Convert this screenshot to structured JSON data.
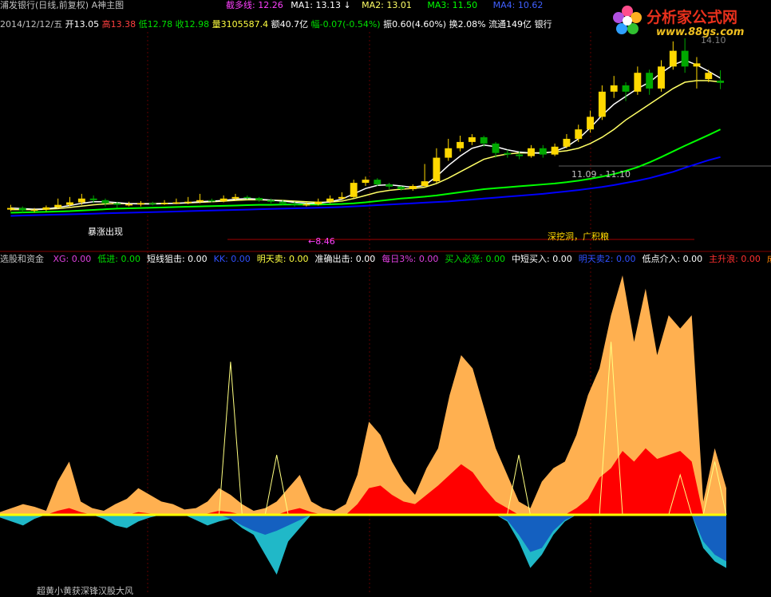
{
  "colors": {
    "background": "#000000",
    "up": "#ffd800",
    "down": "#00a800",
    "ma1": "#ffffff",
    "ma2": "#ffff66",
    "ma3": "#00ff00",
    "ma4": "#0000ff",
    "orange_area": "#ffb050",
    "red_area": "#ff0000",
    "cyan_area": "#20b8c8",
    "blue_area": "#1460c0",
    "zero_line": "#ffff00"
  },
  "header": {
    "title": "浦发银行(日线,前复权) A神主图",
    "ind1_label": "截多线:",
    "ind1_value": "12.26",
    "ma1_label": "MA1:",
    "ma1_value": "13.13",
    "ma1_arrow": "↓",
    "ma2_label": "MA2:",
    "ma2_value": "13.01",
    "ma3_label": "MA3:",
    "ma3_value": "11.50",
    "ma4_label": "MA4:",
    "ma4_value": "10.62"
  },
  "quote": {
    "date": "2014/12/12/五",
    "open": "开13.05",
    "high": "高13.38",
    "low": "低12.78",
    "close": "收12.98",
    "volume": "量3105587.4",
    "amount": "额40.7亿",
    "change": "幅-0.07(-0.54%)",
    "amplitude": "振0.60(4.60%)",
    "turnover": "换2.08%",
    "float_cap": "流通149亿",
    "sector": "银行"
  },
  "logo": {
    "title": "分析家公式网",
    "url": "www.88gs.com"
  },
  "annotations": {
    "hi": "14.10",
    "mid_label": "11.09 - 11.10",
    "low_label": "←8.46",
    "signal_text": "深挖洞，广积粮",
    "left_text": "暴涨出现",
    "bottom_text": "超黄小黄获深锋汉股大风"
  },
  "sub": {
    "title": "选股和资金",
    "items": [
      {
        "label": "XG: 0.00",
        "color": "#e040e0"
      },
      {
        "label": "低进: 0.00",
        "color": "#00e000"
      },
      {
        "label": "短线狙击: 0.00",
        "color": "#ffffff"
      },
      {
        "label": "KK: 0.00",
        "color": "#3050ff"
      },
      {
        "label": "明天卖: 0.00",
        "color": "#ffff40"
      },
      {
        "label": "准确出击: 0.00",
        "color": "#ffffff"
      },
      {
        "label": "每日3%: 0.00",
        "color": "#e040e0"
      },
      {
        "label": "买入必涨: 0.00",
        "color": "#00e000"
      },
      {
        "label": "中短买入: 0.00",
        "color": "#ffffff"
      },
      {
        "label": "明天卖2: 0.00",
        "color": "#3050ff"
      },
      {
        "label": "低点介入: 0.00",
        "color": "#ffffff"
      },
      {
        "label": "主升浪: 0.00",
        "color": "#ff3030"
      },
      {
        "label": "成",
        "color": "#ff8000"
      }
    ]
  },
  "chart_data": [
    {
      "type": "candlestick",
      "title": "浦发银行(日线,前复权) A神主图",
      "ylim": [
        8.0,
        14.6
      ],
      "candles": [
        {
          "o": 8.95,
          "c": 9.0,
          "h": 9.1,
          "l": 8.9
        },
        {
          "o": 9.0,
          "c": 8.92,
          "h": 9.05,
          "l": 8.85
        },
        {
          "o": 8.92,
          "c": 8.95,
          "h": 9.0,
          "l": 8.86
        },
        {
          "o": 8.95,
          "c": 9.02,
          "h": 9.08,
          "l": 8.9
        },
        {
          "o": 9.02,
          "c": 9.1,
          "h": 9.3,
          "l": 9.0
        },
        {
          "o": 9.1,
          "c": 9.18,
          "h": 9.35,
          "l": 9.05
        },
        {
          "o": 9.18,
          "c": 9.3,
          "h": 9.45,
          "l": 9.1
        },
        {
          "o": 9.3,
          "c": 9.25,
          "h": 9.4,
          "l": 9.15
        },
        {
          "o": 9.25,
          "c": 9.15,
          "h": 9.3,
          "l": 9.05
        },
        {
          "o": 9.15,
          "c": 9.1,
          "h": 9.2,
          "l": 9.0
        },
        {
          "o": 9.1,
          "c": 9.12,
          "h": 9.2,
          "l": 9.05
        },
        {
          "o": 9.12,
          "c": 9.15,
          "h": 9.22,
          "l": 9.05
        },
        {
          "o": 9.15,
          "c": 9.12,
          "h": 9.2,
          "l": 9.08
        },
        {
          "o": 9.12,
          "c": 9.16,
          "h": 9.25,
          "l": 9.1
        },
        {
          "o": 9.16,
          "c": 9.18,
          "h": 9.3,
          "l": 9.12
        },
        {
          "o": 9.18,
          "c": 9.2,
          "h": 9.35,
          "l": 9.12
        },
        {
          "o": 9.2,
          "c": 9.25,
          "h": 9.45,
          "l": 9.15
        },
        {
          "o": 9.25,
          "c": 9.22,
          "h": 9.3,
          "l": 9.18
        },
        {
          "o": 9.22,
          "c": 9.3,
          "h": 9.4,
          "l": 9.18
        },
        {
          "o": 9.3,
          "c": 9.35,
          "h": 9.45,
          "l": 9.25
        },
        {
          "o": 9.35,
          "c": 9.32,
          "h": 9.4,
          "l": 9.28
        },
        {
          "o": 9.32,
          "c": 9.25,
          "h": 9.35,
          "l": 9.2
        },
        {
          "o": 9.25,
          "c": 9.2,
          "h": 9.3,
          "l": 9.15
        },
        {
          "o": 9.2,
          "c": 9.15,
          "h": 9.25,
          "l": 9.1
        },
        {
          "o": 9.15,
          "c": 9.1,
          "h": 9.2,
          "l": 9.05
        },
        {
          "o": 9.1,
          "c": 9.12,
          "h": 9.18,
          "l": 9.05
        },
        {
          "o": 9.12,
          "c": 9.2,
          "h": 9.3,
          "l": 9.08
        },
        {
          "o": 9.2,
          "c": 9.3,
          "h": 9.4,
          "l": 9.15
        },
        {
          "o": 9.3,
          "c": 9.35,
          "h": 9.5,
          "l": 9.25
        },
        {
          "o": 9.35,
          "c": 9.8,
          "h": 9.9,
          "l": 9.3
        },
        {
          "o": 9.8,
          "c": 9.9,
          "h": 10.0,
          "l": 9.7
        },
        {
          "o": 9.9,
          "c": 9.75,
          "h": 9.95,
          "l": 9.7
        },
        {
          "o": 9.75,
          "c": 9.68,
          "h": 9.8,
          "l": 9.6
        },
        {
          "o": 9.68,
          "c": 9.6,
          "h": 9.7,
          "l": 9.55
        },
        {
          "o": 9.6,
          "c": 9.7,
          "h": 9.75,
          "l": 9.55
        },
        {
          "o": 9.7,
          "c": 9.85,
          "h": 10.4,
          "l": 9.65
        },
        {
          "o": 9.85,
          "c": 10.6,
          "h": 10.9,
          "l": 9.8
        },
        {
          "o": 10.6,
          "c": 10.9,
          "h": 11.2,
          "l": 10.5
        },
        {
          "o": 10.9,
          "c": 11.1,
          "h": 11.3,
          "l": 10.8
        },
        {
          "o": 11.1,
          "c": 11.25,
          "h": 11.35,
          "l": 11.0
        },
        {
          "o": 11.25,
          "c": 11.05,
          "h": 11.3,
          "l": 10.95
        },
        {
          "o": 11.05,
          "c": 10.75,
          "h": 11.1,
          "l": 10.6
        },
        {
          "o": 10.75,
          "c": 10.7,
          "h": 10.85,
          "l": 10.6
        },
        {
          "o": 10.7,
          "c": 10.65,
          "h": 10.8,
          "l": 10.55
        },
        {
          "o": 10.65,
          "c": 10.9,
          "h": 11.0,
          "l": 10.6
        },
        {
          "o": 10.9,
          "c": 10.7,
          "h": 11.0,
          "l": 10.6
        },
        {
          "o": 10.7,
          "c": 10.95,
          "h": 11.05,
          "l": 10.65
        },
        {
          "o": 10.95,
          "c": 11.2,
          "h": 11.35,
          "l": 10.9
        },
        {
          "o": 11.2,
          "c": 11.5,
          "h": 11.65,
          "l": 11.1
        },
        {
          "o": 11.5,
          "c": 11.9,
          "h": 12.1,
          "l": 11.4
        },
        {
          "o": 11.9,
          "c": 12.7,
          "h": 12.9,
          "l": 11.8
        },
        {
          "o": 12.7,
          "c": 12.9,
          "h": 13.2,
          "l": 12.5
        },
        {
          "o": 12.9,
          "c": 12.7,
          "h": 13.0,
          "l": 12.4
        },
        {
          "o": 12.7,
          "c": 13.3,
          "h": 13.5,
          "l": 12.6
        },
        {
          "o": 13.3,
          "c": 12.8,
          "h": 13.4,
          "l": 12.6
        },
        {
          "o": 12.8,
          "c": 13.5,
          "h": 13.7,
          "l": 12.7
        },
        {
          "o": 13.5,
          "c": 14.0,
          "h": 14.3,
          "l": 13.4
        },
        {
          "o": 14.0,
          "c": 13.5,
          "h": 14.4,
          "l": 13.3
        },
        {
          "o": 13.5,
          "c": 13.6,
          "h": 13.8,
          "l": 12.8
        },
        {
          "o": 13.1,
          "c": 13.3,
          "h": 13.4,
          "l": 13.0
        },
        {
          "o": 13.05,
          "c": 12.98,
          "h": 13.38,
          "l": 12.78
        }
      ],
      "ma1": [
        9.0,
        8.98,
        8.96,
        8.97,
        9.02,
        9.08,
        9.15,
        9.2,
        9.2,
        9.17,
        9.14,
        9.13,
        9.13,
        9.14,
        9.15,
        9.17,
        9.2,
        9.22,
        9.24,
        9.28,
        9.3,
        9.28,
        9.25,
        9.22,
        9.18,
        9.15,
        9.15,
        9.2,
        9.28,
        9.45,
        9.62,
        9.72,
        9.74,
        9.7,
        9.66,
        9.72,
        10.0,
        10.35,
        10.65,
        10.9,
        11.0,
        10.95,
        10.85,
        10.78,
        10.75,
        10.74,
        10.8,
        10.95,
        11.2,
        11.55,
        11.95,
        12.3,
        12.55,
        12.8,
        13.0,
        13.3,
        13.55,
        13.7,
        13.55,
        13.35,
        13.13
      ],
      "ma2": [
        8.95,
        8.95,
        8.95,
        8.96,
        8.98,
        9.02,
        9.06,
        9.1,
        9.13,
        9.14,
        9.14,
        9.14,
        9.14,
        9.15,
        9.15,
        9.16,
        9.18,
        9.2,
        9.22,
        9.24,
        9.26,
        9.26,
        9.25,
        9.24,
        9.22,
        9.2,
        9.18,
        9.19,
        9.22,
        9.3,
        9.4,
        9.5,
        9.56,
        9.6,
        9.62,
        9.66,
        9.78,
        9.95,
        10.15,
        10.35,
        10.55,
        10.65,
        10.72,
        10.75,
        10.75,
        10.76,
        10.78,
        10.82,
        10.9,
        11.05,
        11.25,
        11.5,
        11.8,
        12.05,
        12.3,
        12.55,
        12.8,
        13.0,
        13.05,
        13.05,
        13.01
      ],
      "ma3": [
        8.85,
        8.86,
        8.87,
        8.88,
        8.89,
        8.9,
        8.92,
        8.94,
        8.96,
        8.98,
        8.99,
        9.0,
        9.01,
        9.02,
        9.03,
        9.04,
        9.05,
        9.06,
        9.07,
        9.08,
        9.09,
        9.1,
        9.1,
        9.11,
        9.11,
        9.11,
        9.11,
        9.12,
        9.13,
        9.15,
        9.18,
        9.22,
        9.26,
        9.3,
        9.33,
        9.36,
        9.4,
        9.45,
        9.5,
        9.55,
        9.6,
        9.63,
        9.66,
        9.69,
        9.72,
        9.75,
        9.78,
        9.82,
        9.87,
        9.93,
        10.0,
        10.08,
        10.18,
        10.3,
        10.45,
        10.62,
        10.8,
        10.98,
        11.15,
        11.32,
        11.5
      ],
      "ma4": [
        8.75,
        8.76,
        8.77,
        8.78,
        8.79,
        8.8,
        8.81,
        8.82,
        8.83,
        8.84,
        8.85,
        8.86,
        8.87,
        8.88,
        8.89,
        8.9,
        8.91,
        8.92,
        8.93,
        8.94,
        8.95,
        8.96,
        8.97,
        8.98,
        8.99,
        9.0,
        9.01,
        9.02,
        9.03,
        9.05,
        9.07,
        9.09,
        9.11,
        9.13,
        9.15,
        9.17,
        9.19,
        9.21,
        9.24,
        9.27,
        9.3,
        9.33,
        9.36,
        9.39,
        9.42,
        9.45,
        9.49,
        9.53,
        9.57,
        9.62,
        9.67,
        9.73,
        9.8,
        9.87,
        9.95,
        10.05,
        10.15,
        10.28,
        10.4,
        10.52,
        10.62
      ]
    },
    {
      "type": "area",
      "title": "选股和资金",
      "ylim": [
        -60,
        180
      ],
      "series": [
        {
          "name": "orange",
          "values": [
            2,
            5,
            8,
            6,
            3,
            25,
            40,
            10,
            5,
            3,
            8,
            12,
            20,
            15,
            10,
            8,
            4,
            5,
            10,
            20,
            15,
            8,
            3,
            5,
            10,
            20,
            30,
            10,
            5,
            3,
            8,
            30,
            70,
            60,
            40,
            25,
            15,
            35,
            50,
            90,
            120,
            110,
            80,
            50,
            30,
            10,
            5,
            25,
            35,
            40,
            60,
            90,
            110,
            150,
            180,
            130,
            170,
            120,
            150,
            140,
            150,
            10,
            50,
            20
          ]
        },
        {
          "name": "red",
          "values": [
            0,
            0,
            0,
            0,
            0,
            3,
            5,
            2,
            0,
            0,
            0,
            0,
            2,
            1,
            0,
            0,
            0,
            0,
            1,
            3,
            2,
            0,
            0,
            0,
            0,
            3,
            5,
            2,
            0,
            0,
            0,
            8,
            20,
            22,
            15,
            10,
            8,
            15,
            22,
            30,
            38,
            32,
            20,
            10,
            5,
            0,
            0,
            0,
            0,
            0,
            5,
            12,
            28,
            35,
            48,
            40,
            50,
            42,
            45,
            48,
            40,
            0,
            0,
            0
          ]
        },
        {
          "name": "cyan",
          "values": [
            -2,
            -5,
            -8,
            -3,
            0,
            0,
            0,
            0,
            0,
            -3,
            -8,
            -10,
            -5,
            -2,
            0,
            0,
            0,
            -4,
            -8,
            -5,
            -3,
            -10,
            -15,
            -30,
            -45,
            -20,
            -10,
            0,
            0,
            0,
            0,
            0,
            0,
            0,
            0,
            0,
            0,
            0,
            0,
            0,
            0,
            0,
            0,
            0,
            -5,
            -20,
            -40,
            -30,
            -15,
            -5,
            0,
            0,
            0,
            0,
            0,
            0,
            0,
            0,
            0,
            0,
            0,
            -25,
            -35,
            -40
          ]
        },
        {
          "name": "blue",
          "values": [
            0,
            0,
            0,
            0,
            0,
            0,
            0,
            0,
            0,
            0,
            0,
            0,
            0,
            0,
            0,
            0,
            0,
            0,
            0,
            0,
            -3,
            -8,
            -12,
            -15,
            -12,
            -8,
            -4,
            0,
            0,
            0,
            0,
            0,
            0,
            0,
            0,
            0,
            0,
            0,
            0,
            0,
            0,
            0,
            0,
            0,
            -4,
            -15,
            -28,
            -25,
            -12,
            -4,
            0,
            0,
            0,
            0,
            0,
            0,
            0,
            0,
            0,
            0,
            0,
            -20,
            -30,
            -35
          ]
        },
        {
          "name": "yellow_line",
          "values": [
            0,
            0,
            0,
            0,
            0,
            0,
            0,
            0,
            0,
            0,
            0,
            0,
            0,
            0,
            0,
            0,
            0,
            0,
            0,
            0,
            115,
            0,
            0,
            0,
            45,
            0,
            0,
            0,
            0,
            0,
            0,
            0,
            0,
            0,
            0,
            0,
            0,
            0,
            0,
            0,
            0,
            0,
            0,
            0,
            0,
            45,
            0,
            0,
            0,
            0,
            0,
            0,
            0,
            130,
            0,
            0,
            0,
            0,
            0,
            30,
            0,
            0,
            40,
            0
          ]
        }
      ]
    }
  ]
}
